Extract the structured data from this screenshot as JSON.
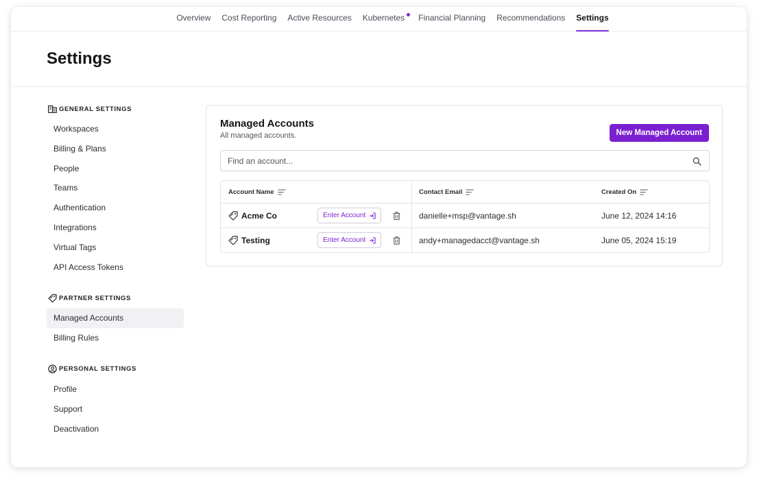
{
  "nav": {
    "tabs": [
      {
        "label": "Overview"
      },
      {
        "label": "Cost Reporting"
      },
      {
        "label": "Active Resources"
      },
      {
        "label": "Kubernetes"
      },
      {
        "label": "Financial Planning"
      },
      {
        "label": "Recommendations"
      },
      {
        "label": "Settings"
      }
    ],
    "active_tab": "Settings",
    "accent_color": "#7b2bd6"
  },
  "header": {
    "title": "Settings"
  },
  "sidebar": {
    "sections": [
      {
        "title": "GENERAL SETTINGS",
        "icon": "building-icon",
        "items": [
          "Workspaces",
          "Billing & Plans",
          "People",
          "Teams",
          "Authentication",
          "Integrations",
          "Virtual Tags",
          "API Access Tokens"
        ]
      },
      {
        "title": "PARTNER SETTINGS",
        "icon": "tag-icon",
        "items": [
          "Managed Accounts",
          "Billing Rules"
        ]
      },
      {
        "title": "PERSONAL SETTINGS",
        "icon": "user-circle-icon",
        "items": [
          "Profile",
          "Support",
          "Deactivation"
        ]
      }
    ],
    "active_item": "Managed Accounts"
  },
  "main": {
    "title": "Managed Accounts",
    "subtitle": "All managed accounts.",
    "new_button_label": "New Managed Account",
    "search_placeholder": "Find an account...",
    "table": {
      "columns": [
        "Account Name",
        "Contact Email",
        "Created On"
      ],
      "enter_label": "Enter Account",
      "rows": [
        {
          "name": "Acme Co",
          "email": "danielle+msp@vantage.sh",
          "created": "June 12, 2024 14:16"
        },
        {
          "name": "Testing",
          "email": "andy+managedacct@vantage.sh",
          "created": "June 05, 2024 15:19"
        }
      ]
    }
  },
  "colors": {
    "primary": "#7b1fd1",
    "border": "#e3e3e8",
    "active_bg": "#f1f1f4"
  }
}
